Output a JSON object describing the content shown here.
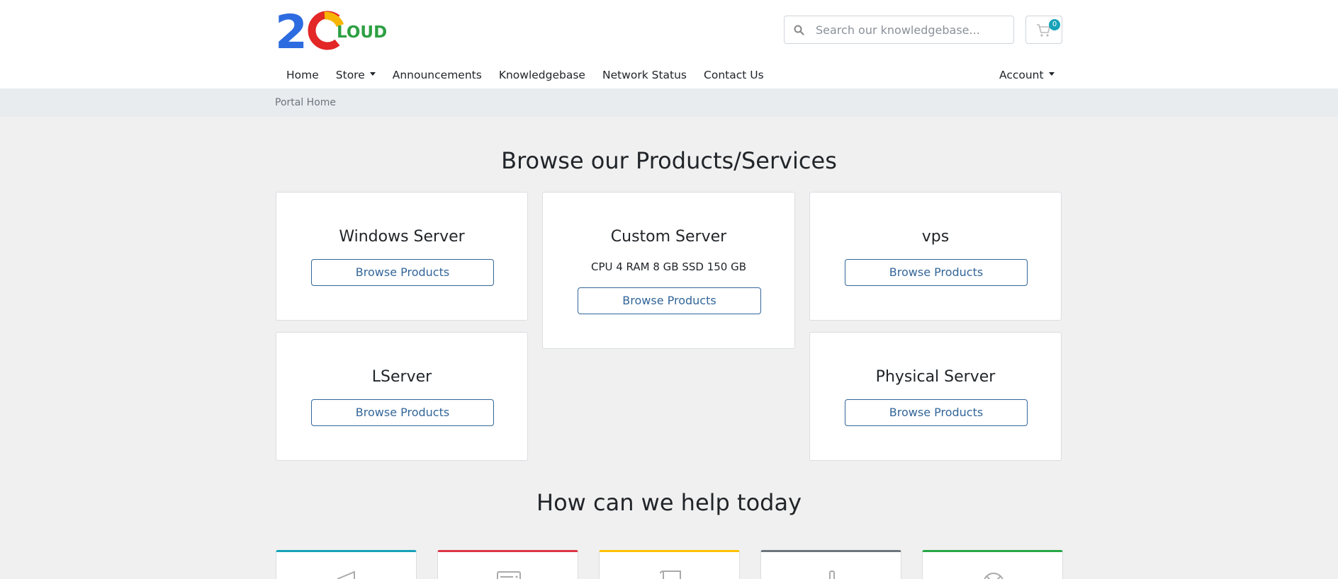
{
  "brand": {
    "logo_text": "2CLOUD"
  },
  "search": {
    "placeholder": "Search our knowledgebase..."
  },
  "cart": {
    "count": "0"
  },
  "nav": {
    "items": [
      {
        "label": "Home"
      },
      {
        "label": "Store"
      },
      {
        "label": "Announcements"
      },
      {
        "label": "Knowledgebase"
      },
      {
        "label": "Network Status"
      },
      {
        "label": "Contact Us"
      }
    ],
    "account": "Account"
  },
  "breadcrumb": {
    "label": "Portal Home"
  },
  "products": {
    "heading": "Browse our Products/Services",
    "cards": [
      {
        "title": "Windows Server",
        "description": "",
        "button": "Browse Products"
      },
      {
        "title": "Custom Server",
        "description": "CPU 4 RAM 8 GB SSD 150 GB",
        "button": "Browse Products"
      },
      {
        "title": "vps",
        "description": "",
        "button": "Browse Products"
      },
      {
        "title": "LServer",
        "description": "",
        "button": "Browse Products"
      },
      {
        "title": "Physical Server",
        "description": "",
        "button": "Browse Products"
      }
    ]
  },
  "help": {
    "heading": "How can we help today",
    "tiles": [
      {
        "icon": "megaphone-icon",
        "color": "#17a2b8"
      },
      {
        "icon": "server-icon",
        "color": "#dc3545"
      },
      {
        "icon": "book-icon",
        "color": "#ffc107"
      },
      {
        "icon": "rocket-icon",
        "color": "#6c757d"
      },
      {
        "icon": "support-icon",
        "color": "#28a745"
      }
    ]
  },
  "colors": {
    "accent": "#336699",
    "badge": "#17a2b8"
  }
}
